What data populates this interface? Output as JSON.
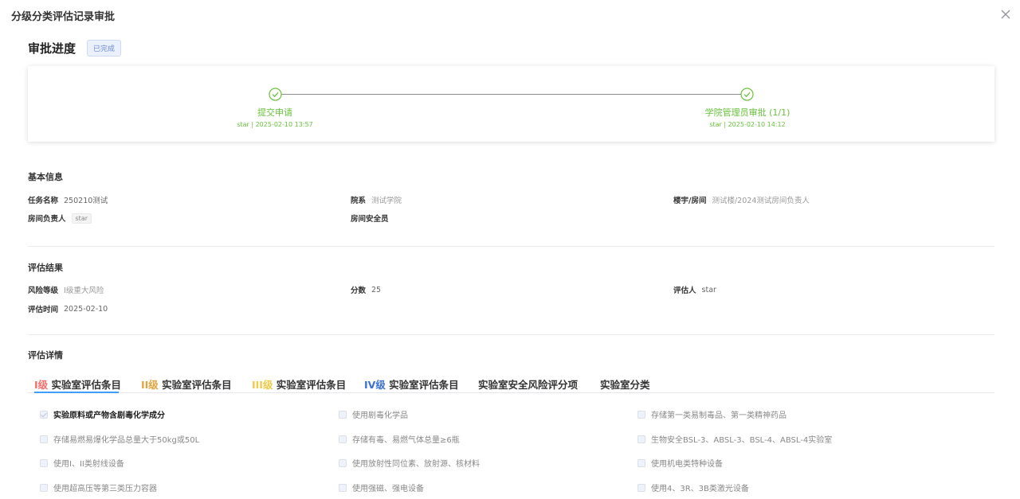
{
  "dialog": {
    "title": "分级分类评估记录审批"
  },
  "approval": {
    "heading": "审批进度",
    "status": "已完成",
    "steps": [
      {
        "title": "提交申请",
        "meta": "star | 2025-02-10 13:57"
      },
      {
        "title": "学院管理员审批 (1/1)",
        "meta": "star | 2025-02-10 14:12"
      }
    ]
  },
  "basic": {
    "title": "基本信息",
    "task_label": "任务名称",
    "task_value": "250210测试",
    "dept_label": "院系",
    "dept_value": "测试学院",
    "room_label": "楼宇/房间",
    "room_value": "测试楼/2024测试房间负责人",
    "owner_label": "房间负责人",
    "owner_value": "star",
    "safety_label": "房间安全员",
    "safety_value": ""
  },
  "result": {
    "title": "评估结果",
    "risk_label": "风险等级",
    "risk_value": "I级重大风险",
    "score_label": "分数",
    "score_value": "25",
    "assessor_label": "评估人",
    "assessor_value": "star",
    "time_label": "评估时间",
    "time_value": "2025-02-10"
  },
  "details": {
    "title": "评估详情",
    "tabs": [
      {
        "level": "I级",
        "label": " 实验室评估条目",
        "color": "#f56c6c"
      },
      {
        "level": "II级",
        "label": " 实验室评估条目",
        "color": "#e6a23c"
      },
      {
        "level": "III级",
        "label": " 实验室评估条目",
        "color": "#f0c94a"
      },
      {
        "level": "IV级",
        "label": " 实验室评估条目",
        "color": "#3a6fd8"
      },
      {
        "level": "",
        "label": "实验室安全风险评分项",
        "color": "#333333"
      },
      {
        "level": "",
        "label": "实验室分类",
        "color": "#333333"
      }
    ],
    "active_tab_color": "#409eff",
    "items": [
      "实验原料或产物含剧毒化学成分",
      "使用剧毒化学品",
      "存储第一类易制毒品、第一类精神药品",
      "存储易燃易爆化学品总量大于50kg或50L",
      "存储有毒、易燃气体总量≥6瓶",
      "生物安全BSL-3、ABSL-3、BSL-4、ABSL-4实验室",
      "使用I、II类射线设备",
      "使用放射性同位素、放射源、核材料",
      "使用机电类特种设备",
      "使用超高压等第三类压力容器",
      "使用强磁、强电设备",
      "使用4、3R、3B类激光设备"
    ],
    "checked": [
      true,
      false,
      false,
      false,
      false,
      false,
      false,
      false,
      false,
      false,
      false,
      false
    ]
  }
}
